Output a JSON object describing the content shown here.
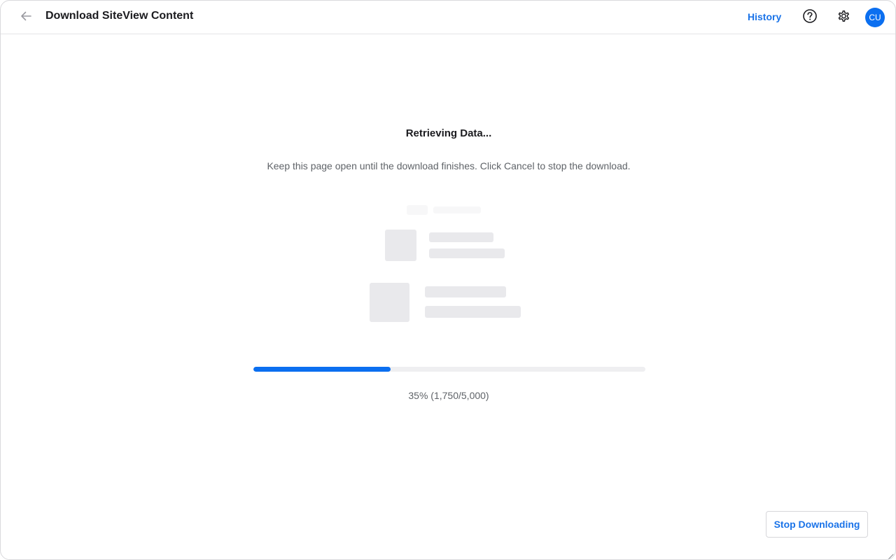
{
  "header": {
    "back_icon": "arrow-left-icon",
    "title": "Download SiteView Content",
    "history_label": "History",
    "help_icon": "question-circle-icon",
    "settings_icon": "gear-icon",
    "avatar_initials": "CU",
    "accent_color": "#1a73e8"
  },
  "status": {
    "title": "Retrieving Data...",
    "description": "Keep this page open until the download finishes. Click Cancel to stop the download."
  },
  "progress": {
    "percent": 35,
    "current": 1750,
    "total": 5000,
    "label": "35% (1,750/5,000)",
    "fill_color": "#0b6ff0"
  },
  "actions": {
    "stop_label": "Stop Downloading"
  }
}
